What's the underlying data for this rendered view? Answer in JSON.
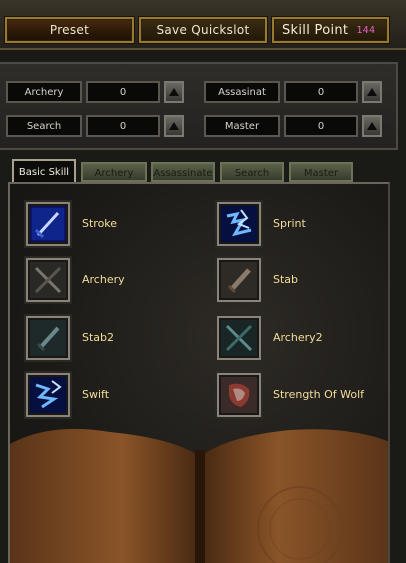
{
  "topbar": {
    "preset_label": "Preset",
    "save_quickslot_label": "Save Quickslot",
    "skill_point_label": "Skill Point",
    "skill_point_value": "144"
  },
  "stats": [
    {
      "label": "Archery",
      "value": "0"
    },
    {
      "label": "Assasinat",
      "value": "0"
    },
    {
      "label": "Search",
      "value": "0"
    },
    {
      "label": "Master",
      "value": "0"
    }
  ],
  "tabs": [
    {
      "label": "Basic Skill",
      "active": true
    },
    {
      "label": "Archery",
      "active": false
    },
    {
      "label": "Assassinate",
      "active": false
    },
    {
      "label": "Search",
      "active": false
    },
    {
      "label": "Master",
      "active": false
    }
  ],
  "skills": [
    {
      "name": "Stroke",
      "icon": "blue-sword-icon"
    },
    {
      "name": "Sprint",
      "icon": "blue-lightning-icon"
    },
    {
      "name": "Archery",
      "icon": "bow-icon"
    },
    {
      "name": "Stab",
      "icon": "dagger-icon"
    },
    {
      "name": "Stab2",
      "icon": "dagger-icon"
    },
    {
      "name": "Archery2",
      "icon": "crossed-bow-icon"
    },
    {
      "name": "Swift",
      "icon": "blue-lightning-icon"
    },
    {
      "name": "Strength Of Wolf",
      "icon": "wolf-icon"
    }
  ],
  "colors": {
    "skill_name": "#f2dd9a",
    "skill_point_value": "#e060c0",
    "gold_border": "#9a7a2e"
  }
}
